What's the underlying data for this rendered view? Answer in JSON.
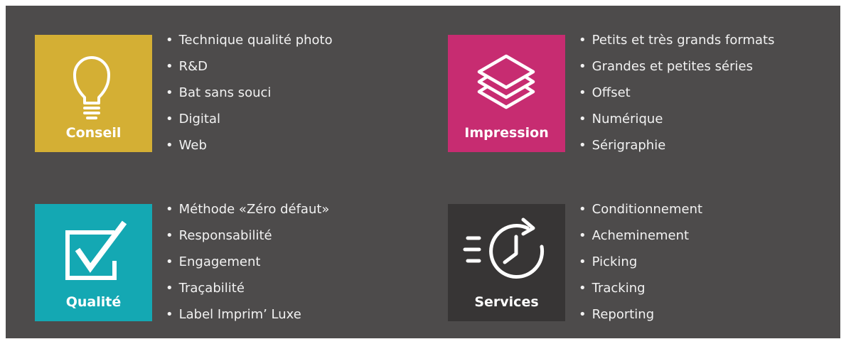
{
  "colors": {
    "background": "#4d4b4b",
    "conseil": "#d4af34",
    "impression": "#c72c71",
    "qualite": "#14a8b3",
    "services": "#373535",
    "text": "#f2f2f2"
  },
  "blocks": [
    {
      "label": "Conseil",
      "icon": "lightbulb-icon",
      "items": [
        "Technique qualité photo",
        "R&D",
        "Bat sans souci",
        "Digital",
        "Web"
      ]
    },
    {
      "label": "Impression",
      "icon": "layers-icon",
      "items": [
        "Petits et très grands formats",
        "Grandes et petites séries",
        "Offset",
        "Numérique",
        "Sérigraphie"
      ]
    },
    {
      "label": "Qualité",
      "icon": "checkbox-icon",
      "items": [
        "Méthode «Zéro défaut»",
        "Responsabilité",
        "Engagement",
        "Traçabilité",
        "Label Imprim’ Luxe"
      ]
    },
    {
      "label": "Services",
      "icon": "fast-clock-icon",
      "items": [
        "Conditionnement",
        "Acheminement",
        "Picking",
        "Tracking",
        "Reporting"
      ]
    }
  ]
}
